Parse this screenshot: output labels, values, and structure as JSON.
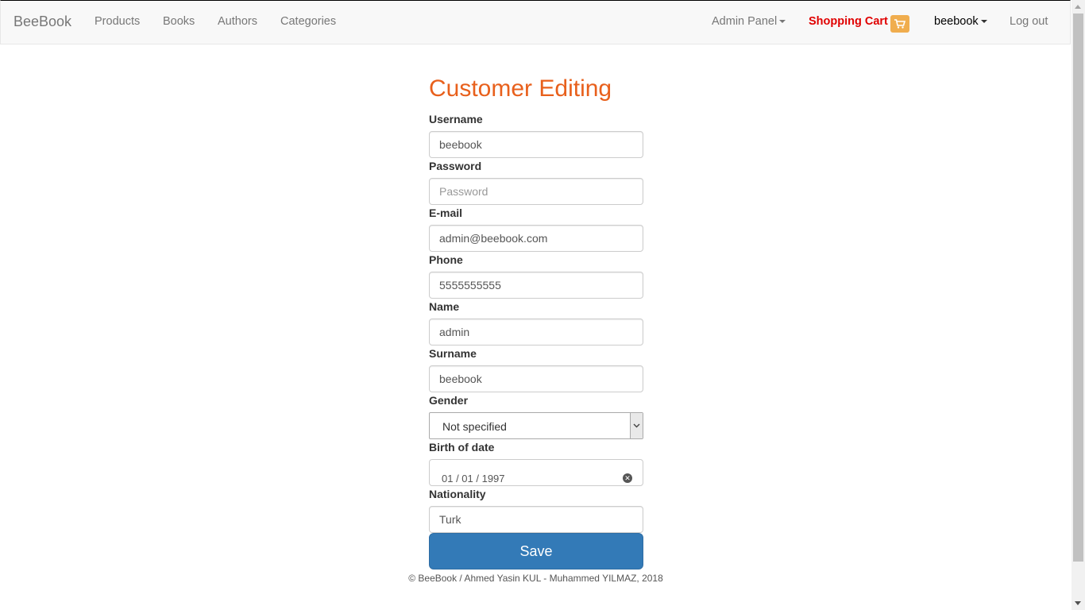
{
  "navbar": {
    "brand": "BeeBook",
    "links": [
      "Products",
      "Books",
      "Authors",
      "Categories"
    ],
    "admin_panel": "Admin Panel",
    "shopping_cart": "Shopping Cart",
    "user": "beebook",
    "logout": "Log out",
    "cart_icon": "shopping-cart-icon"
  },
  "form": {
    "title": "Customer Editing",
    "fields": {
      "username": {
        "label": "Username",
        "value": "beebook"
      },
      "password": {
        "label": "Password",
        "value": "",
        "placeholder": "Password"
      },
      "email": {
        "label": "E-mail",
        "value": "admin@beebook.com"
      },
      "phone": {
        "label": "Phone",
        "value": "5555555555"
      },
      "name": {
        "label": "Name",
        "value": "admin"
      },
      "surname": {
        "label": "Surname",
        "value": "beebook"
      },
      "gender": {
        "label": "Gender",
        "value": "Not specified"
      },
      "birth": {
        "label": "Birth of date",
        "value": "01 / 01 / 1997"
      },
      "nationality": {
        "label": "Nationality",
        "value": "Turk"
      }
    },
    "save_label": "Save"
  },
  "footer": "© BeeBook / Ahmed Yasin KUL - Muhammed YILMAZ, 2018",
  "colors": {
    "title": "#e8601c",
    "cart_text": "#e00000",
    "cart_icon_bg": "#f0ad4e",
    "primary": "#337ab7"
  }
}
